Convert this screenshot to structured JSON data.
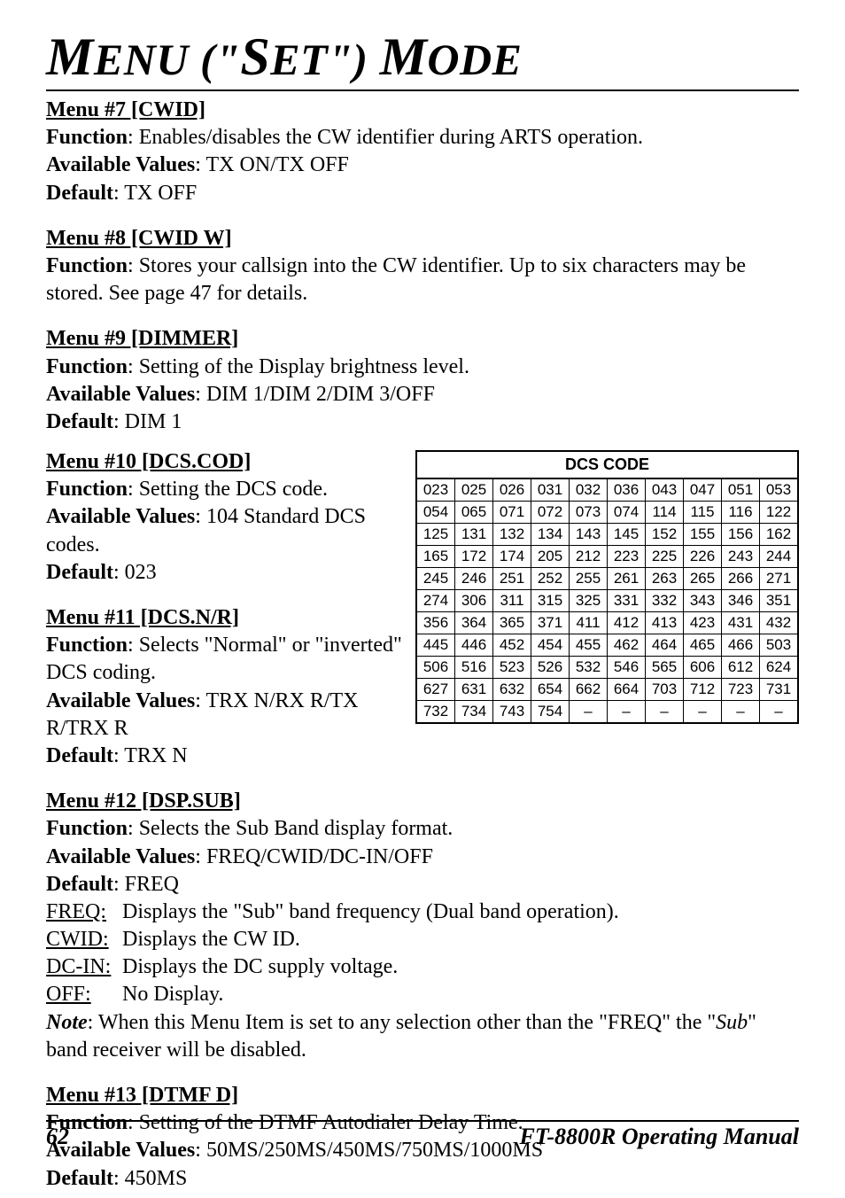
{
  "title_html": "MENU (\"SET\") MODE",
  "menus": {
    "m7": {
      "head": "Menu #7 [CWID]",
      "function": "Enables/disables the CW identifier during ARTS operation.",
      "values": "TX ON/TX OFF",
      "default": "TX OFF"
    },
    "m8": {
      "head": "Menu #8 [CWID W]",
      "function": "Stores your callsign into the CW identifier. Up to six characters may be stored. See page 47 for details."
    },
    "m9": {
      "head": "Menu #9 [DIMMER]",
      "function": "Setting of the Display brightness level.",
      "values": "DIM 1/DIM 2/DIM 3/OFF",
      "default": "DIM 1"
    },
    "m10": {
      "head": "Menu #10 [DCS.COD]",
      "function": "Setting the DCS code.",
      "values": "104 Standard DCS codes.",
      "default": "023"
    },
    "m11": {
      "head": "Menu #11 [DCS.N/R]",
      "function": "Selects \"Normal\" or \"inverted\" DCS coding.",
      "values": "TRX N/RX R/TX R/TRX R",
      "default": "TRX N"
    },
    "m12": {
      "head": "Menu #12 [DSP.SUB]",
      "function": "Selects the Sub Band display format.",
      "values": "FREQ/CWID/DC-IN/OFF",
      "default": "FREQ",
      "defs": {
        "freq": {
          "term": "FREQ:",
          "desc": "Displays the \"Sub\" band frequency (Dual band operation)."
        },
        "cwid": {
          "term": "CWID:",
          "desc": "Displays the CW ID."
        },
        "dcin": {
          "term": "DC-IN:",
          "desc": "Displays the DC supply voltage."
        },
        "off": {
          "term": "OFF:",
          "desc": "No Display."
        }
      },
      "note_prefix": "Note",
      "note_body_1": ": When this Menu Item is set to any selection other than the \"FREQ\" the \"",
      "note_sub": "Sub",
      "note_body_2": "\" band receiver will be disabled."
    },
    "m13": {
      "head": "Menu #13 [DTMF D]",
      "function": "Setting of the DTMF Autodialer Delay Time.",
      "values": "50MS/250MS/450MS/750MS/1000MS",
      "default": "450MS"
    }
  },
  "labels": {
    "function": "Function",
    "values": "Available Values",
    "default": "Default"
  },
  "dcs": {
    "title": "DCS CODE",
    "rows": [
      [
        "023",
        "025",
        "026",
        "031",
        "032",
        "036",
        "043",
        "047",
        "051",
        "053"
      ],
      [
        "054",
        "065",
        "071",
        "072",
        "073",
        "074",
        "114",
        "115",
        "116",
        "122"
      ],
      [
        "125",
        "131",
        "132",
        "134",
        "143",
        "145",
        "152",
        "155",
        "156",
        "162"
      ],
      [
        "165",
        "172",
        "174",
        "205",
        "212",
        "223",
        "225",
        "226",
        "243",
        "244"
      ],
      [
        "245",
        "246",
        "251",
        "252",
        "255",
        "261",
        "263",
        "265",
        "266",
        "271"
      ],
      [
        "274",
        "306",
        "311",
        "315",
        "325",
        "331",
        "332",
        "343",
        "346",
        "351"
      ],
      [
        "356",
        "364",
        "365",
        "371",
        "411",
        "412",
        "413",
        "423",
        "431",
        "432"
      ],
      [
        "445",
        "446",
        "452",
        "454",
        "455",
        "462",
        "464",
        "465",
        "466",
        "503"
      ],
      [
        "506",
        "516",
        "523",
        "526",
        "532",
        "546",
        "565",
        "606",
        "612",
        "624"
      ],
      [
        "627",
        "631",
        "632",
        "654",
        "662",
        "664",
        "703",
        "712",
        "723",
        "731"
      ],
      [
        "732",
        "734",
        "743",
        "754",
        "–",
        "–",
        "–",
        "–",
        "–",
        "–"
      ]
    ]
  },
  "footer": {
    "page": "62",
    "manual": "FT-8800R Operating Manual"
  }
}
